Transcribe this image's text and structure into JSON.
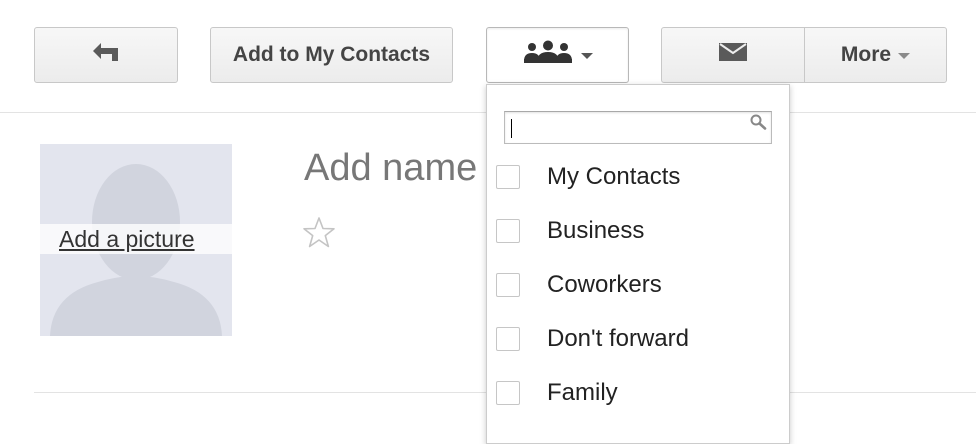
{
  "toolbar": {
    "back_icon": "back-arrow-icon",
    "add_to_contacts_label": "Add to My Contacts",
    "groups_icon": "people-group-icon",
    "email_icon": "envelope-icon",
    "more_label": "More"
  },
  "contact": {
    "add_picture_label": "Add a picture",
    "name_placeholder": "Add name",
    "star_icon": "star-outline-icon"
  },
  "groups_menu": {
    "search_value": "",
    "search_icon": "magnifier-icon",
    "items": [
      {
        "label": "My Contacts",
        "checked": false
      },
      {
        "label": "Business",
        "checked": false
      },
      {
        "label": "Coworkers",
        "checked": false
      },
      {
        "label": "Don't forward",
        "checked": false
      },
      {
        "label": "Family",
        "checked": false
      }
    ]
  },
  "colors": {
    "button_border": "#c8c8c8",
    "button_bg_top": "#f7f7f7",
    "button_bg_bottom": "#ececec",
    "icon_gray": "#555555",
    "placeholder_gray": "#777777"
  }
}
